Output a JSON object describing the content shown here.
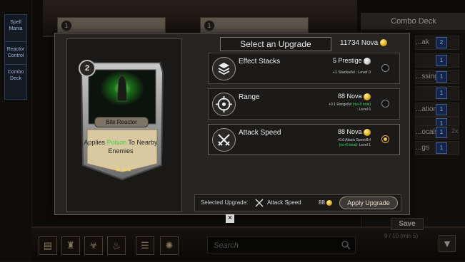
{
  "left_sidebar": {
    "items": [
      "Spell Mania",
      "Reactor Control",
      "Combo Deck"
    ]
  },
  "book": {
    "page_numbers": [
      "1",
      "1"
    ]
  },
  "combo_deck": {
    "title": "Combo Deck",
    "rows": [
      {
        "label": "...ak",
        "count": "2"
      },
      {
        "label": "",
        "count": "1"
      },
      {
        "label": "...ssing",
        "count": "1"
      },
      {
        "label": "",
        "count": "1"
      },
      {
        "label": "...ations",
        "count": "1"
      },
      {
        "label": "",
        "count": "1"
      },
      {
        "label": "...ocals",
        "count": "1"
      },
      {
        "label": "...gs",
        "count": "1"
      }
    ],
    "multiplier": "2x",
    "save_label": "Save",
    "deck_count": "9 / 10  (min 5)"
  },
  "bottom_bar": {
    "icons": [
      "book-icon",
      "castle-icon",
      "swirl-icon",
      "flame-icon",
      "scroll-icon",
      "burst-icon"
    ],
    "search_placeholder": "Search"
  },
  "modal": {
    "title": "Select an Upgrade",
    "nova_total": "11734 Nova",
    "options": [
      {
        "title": "Effect Stacks",
        "cost": "5 Prestige",
        "currency": "silver",
        "desc_pre": "+1 Stacks/lvl : Level 0",
        "desc_green": "",
        "desc_line2": "",
        "selected": false,
        "icon": "layers-icon"
      },
      {
        "title": "Range",
        "cost": "88 Nova",
        "currency": "gold",
        "desc_pre": "+0.1 Range/lvl ",
        "desc_green": "(no+0 total)",
        "desc_line2": ": Level 6",
        "selected": false,
        "icon": "target-icon"
      },
      {
        "title": "Attack Speed",
        "cost": "88 Nova",
        "currency": "gold",
        "desc_pre": "+0.0 Attack Speed/lvl",
        "desc_green": "(no+0 total)",
        "desc_line2": ": Level 1",
        "selected": true,
        "icon": "crossed-swords-icon"
      }
    ],
    "selected_label": "Selected Upgrade:",
    "selected_name": "Attack Speed",
    "selected_cost": "88",
    "apply_label": "Apply Upgrade",
    "close_label": "×"
  },
  "card": {
    "cost": "2",
    "name": "Bile Reactor",
    "text_before": "Applies ",
    "text_highlight": "Poison",
    "text_after": " To Nearby Enemies",
    "stars": 3
  }
}
